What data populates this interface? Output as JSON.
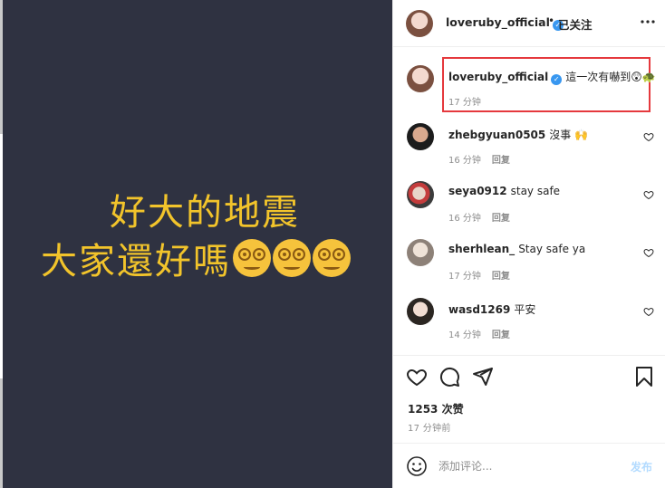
{
  "media": {
    "line1": "好大的地震",
    "line2": "大家還好嗎",
    "emoji_count": 3,
    "emoji_icon": "dizzy-face-icon",
    "background_color": "#2f3241",
    "text_color": "#f2c42b"
  },
  "header": {
    "username": "loveruby_official",
    "verified_icon": "verified-badge-icon",
    "separator": "•",
    "follow_status": "已关注",
    "more_icon": "more-options-icon"
  },
  "caption": {
    "username": "loveruby_official",
    "text": "這一次有嚇到😲🐢",
    "time": "17 分钟",
    "highlight_color": "#e5393d"
  },
  "comments": [
    {
      "username": "zhebgyuan0505",
      "text": "沒事 🙌",
      "time": "16 分钟",
      "reply": "回复"
    },
    {
      "username": "seya0912",
      "text": "stay safe",
      "time": "16 分钟",
      "reply": "回复"
    },
    {
      "username": "sherhlean_",
      "text": "Stay safe ya",
      "time": "17 分钟",
      "reply": "回复"
    },
    {
      "username": "wasd1269",
      "text": "平安",
      "time": "14 分钟",
      "reply": "回复"
    }
  ],
  "actions": {
    "like_icon": "heart-icon",
    "comment_icon": "comment-icon",
    "share_icon": "share-icon",
    "save_icon": "bookmark-icon"
  },
  "likes": "1253 次赞",
  "posted_time": "17 分钟前",
  "add_comment": {
    "emoji_icon": "emoji-icon",
    "placeholder": "添加评论...",
    "post_label": "发布",
    "post_color": "#b3dbff"
  }
}
